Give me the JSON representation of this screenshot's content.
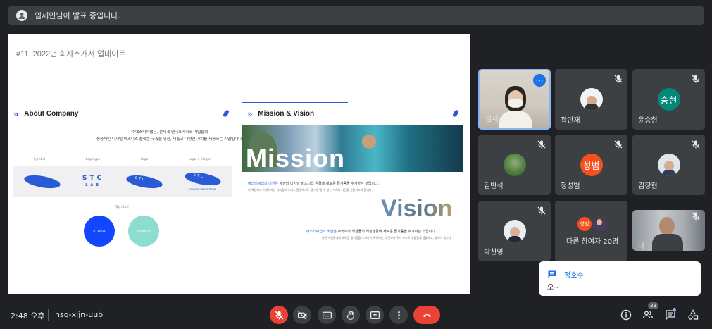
{
  "banner": {
    "text": "임세민님이 발표 중입니다."
  },
  "slide": {
    "title": "#11. 2022년 회사소개서 업데이트",
    "about": {
      "heading": "About Company",
      "desc1": "㈜에스티씨랩은, 전세계 엔터프라이즈 기업들의",
      "desc2": "성공적인 디지털 비즈니스 플랫폼 구축을 위한, 새롭고 다양한 가치를 제공하는 기업입니다.",
      "logo_heads": [
        "Symbol",
        "Logotype",
        "Logo",
        "Logo + Slogan"
      ],
      "stc1": "STC",
      "stc2": "LAB",
      "slogan": "Lively the Heat of Things",
      "symbol_label": "Symbol",
      "circle1": "#1346FF",
      "circle2": "#8DDCD0"
    },
    "mission": {
      "heading": "Mission & Vision",
      "word": "Mission",
      "line1_hl": "에스티씨랩의 미션은",
      "line1_rest": " 세상의 디지털 비즈니스 환경에 새로운 즐거움을 추가하는 것입니다.",
      "line2": "더 복잡하고 어려워지는 디지털 비즈니스 환경에서도 '즐거움'을 수 있는 가치와 시간을 선물하고자 합니다.",
      "vision_word": "Vision",
      "line3_hl": "에스티씨랩의 비전은",
      "line3_rest": " 무엇보다 직원들의 직장생활에 새로운 즐거움을 추가하는 것입니다.",
      "line4": "다른 사람들에게 새로운 즐거움을 추가하기 위해서는, 무엇보다 우리 스스로가 즐겁게 생활하고, 일해야 합니다."
    }
  },
  "participants": [
    {
      "name": "임세민",
      "type": "video",
      "muted": false,
      "active": true
    },
    {
      "name": "곽만재",
      "type": "photo",
      "muted": true
    },
    {
      "name": "윤승현",
      "type": "initial",
      "initial": "승현",
      "color": "#00897b",
      "muted": true
    },
    {
      "name": "김반석",
      "type": "photo",
      "muted": true
    },
    {
      "name": "정성범",
      "type": "initial",
      "initial": "성범",
      "color": "#f4511e",
      "muted": true
    },
    {
      "name": "김창현",
      "type": "photo",
      "muted": true
    },
    {
      "name": "박찬영",
      "type": "photo",
      "muted": true
    },
    {
      "name": "다른 참여자 20명",
      "type": "group",
      "initial": "성범",
      "muted": false
    },
    {
      "name": "나",
      "type": "video",
      "muted": true
    }
  ],
  "chat": {
    "sender": "정호수",
    "message": "오~"
  },
  "bottom": {
    "time": "2:48 오후",
    "meeting_code": "hsq-xjjn-uub",
    "people_count": "29"
  },
  "colors": {
    "accent": "#1a73e8",
    "end_call": "#ea4335",
    "bg": "#202124",
    "tile": "#3c4043"
  }
}
